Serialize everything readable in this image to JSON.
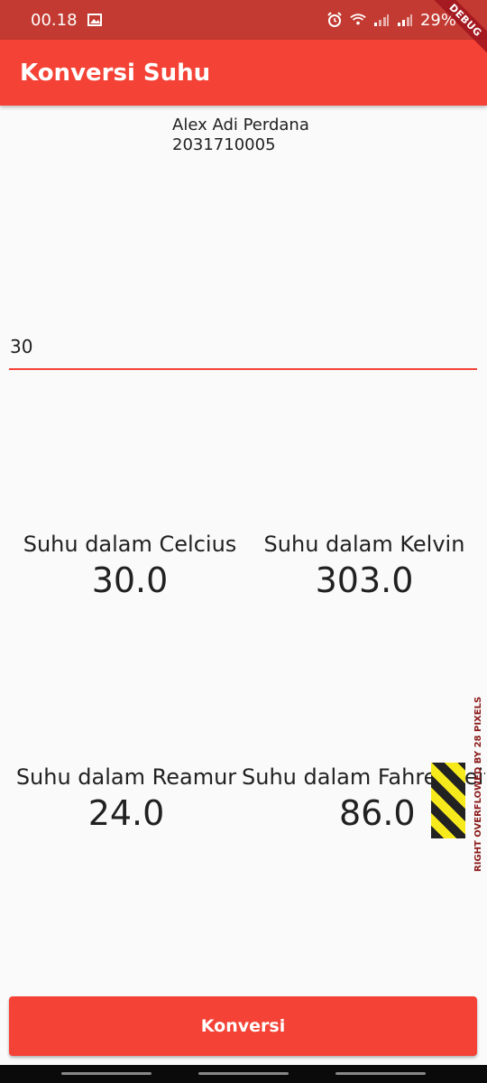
{
  "status_bar": {
    "time": "00.18",
    "battery": "29%",
    "icons": [
      "image-icon",
      "alarm-icon",
      "wifi-icon",
      "signal-icon",
      "signal-icon"
    ]
  },
  "debug_label": "DEBUG",
  "app_bar": {
    "title": "Konversi Suhu"
  },
  "author": {
    "name": "Alex Adi Perdana",
    "id": "2031710005"
  },
  "input": {
    "value": "30"
  },
  "results": {
    "celcius": {
      "label": "Suhu dalam Celcius",
      "value": "30.0"
    },
    "kelvin": {
      "label": "Suhu dalam Kelvin",
      "value": "303.0"
    },
    "reamur": {
      "label": "Suhu dalam Reamur",
      "value": "24.0"
    },
    "fahrenheit": {
      "label": "Suhu dalam Fahrenheit",
      "value": "86.0"
    }
  },
  "overflow_warning": "RIGHT OVERFLOWED BY 28 PIXELS",
  "button": {
    "label": "Konversi"
  },
  "colors": {
    "primary": "#f44236",
    "status_bar": "#c23a31"
  }
}
